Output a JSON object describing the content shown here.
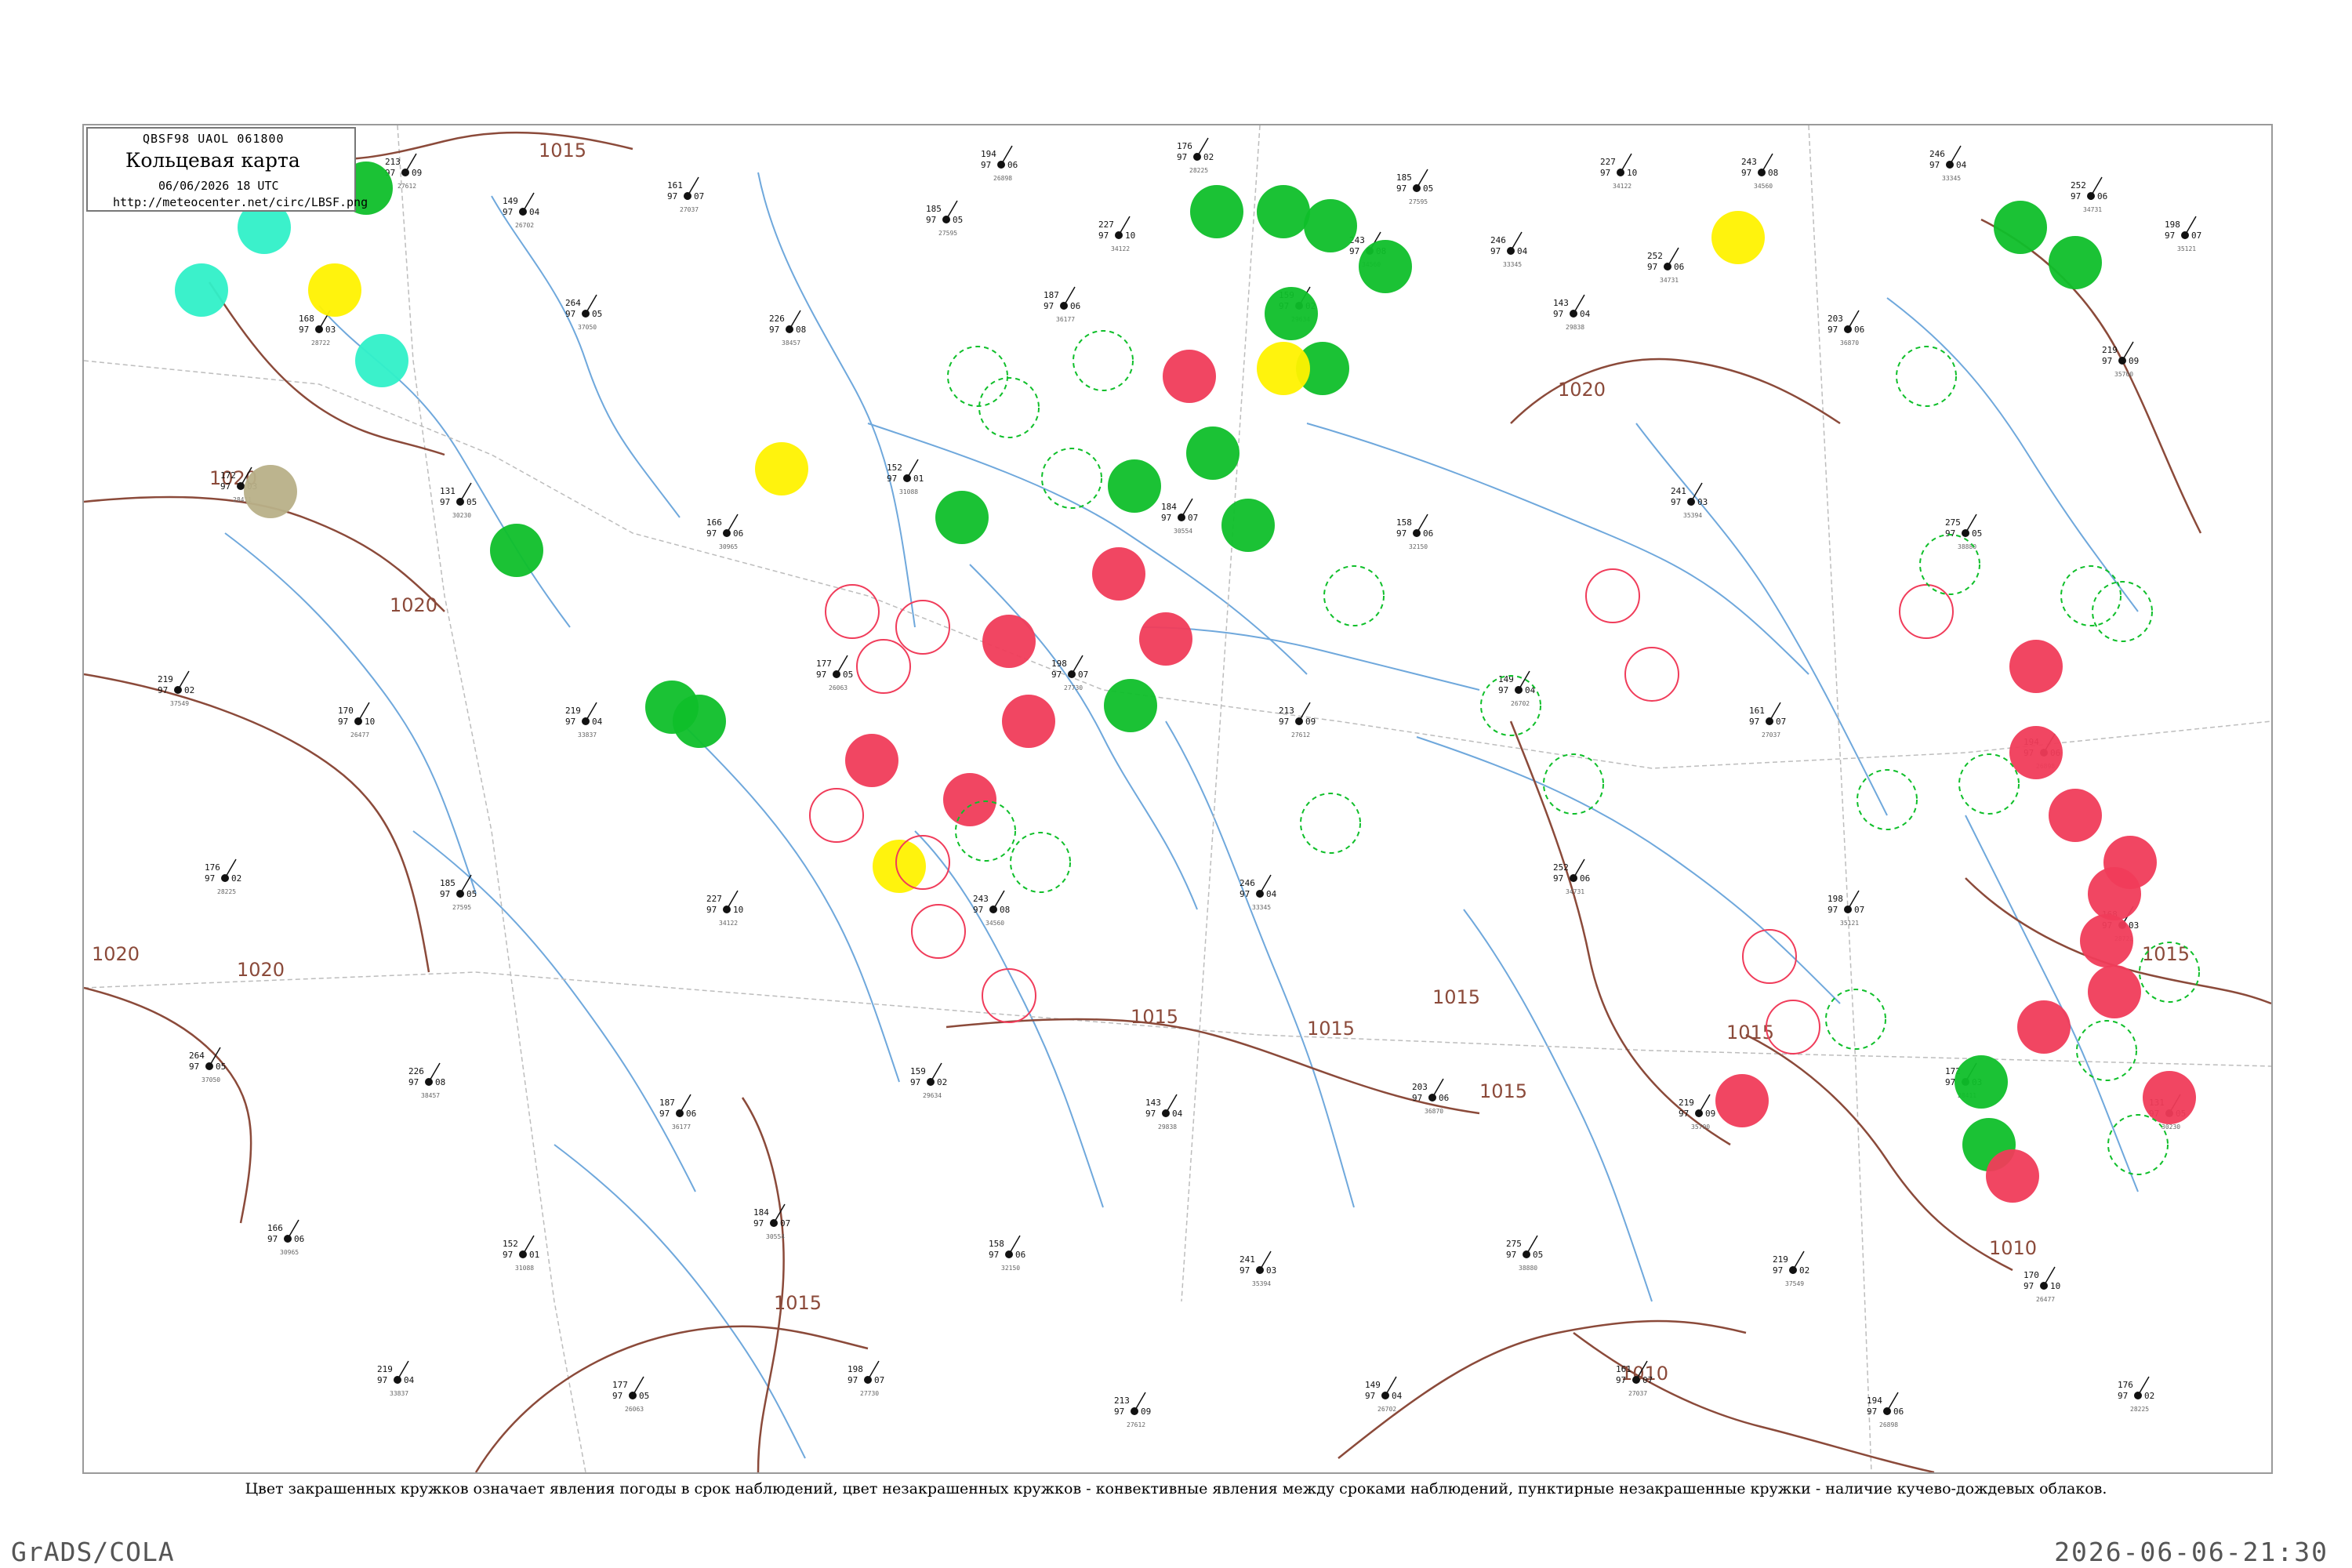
{
  "legend": {
    "header": "QBSF98  UAOL  061800",
    "title": "Кольцевая карта",
    "date": "06/06/2026 18 UTC",
    "url": "http://meteocenter.net/circ/LBSF.png"
  },
  "caption": "Цвет закрашенных кружков означает явления погоды в срок наблюдений, цвет незакрашенных кружков - конвективные явления между сроками наблюдений, пунктирные незакрашенные кружки - наличие кучево-дождевых облаков.",
  "footer": {
    "left": "GrADS/COLA",
    "right": "2026-06-06-21:30"
  },
  "colors": {
    "green": "#0fbf2a",
    "red": "#f03c5a",
    "yellow": "#fff200",
    "cyan": "#30f0c8",
    "olive": "#b8b088",
    "isobar": "#8b4a3a",
    "river": "#6fa8dc",
    "border": "#bdbdbd"
  },
  "isobars": [
    {
      "label": "1015"
    },
    {
      "label": "1020"
    },
    {
      "label": "1020"
    },
    {
      "label": "1020"
    },
    {
      "label": "1020"
    },
    {
      "label": "1015"
    },
    {
      "label": "1015"
    },
    {
      "label": "1015"
    },
    {
      "label": "1015"
    },
    {
      "label": "1015"
    },
    {
      "label": "1010"
    },
    {
      "label": "1010"
    },
    {
      "label": "1015"
    },
    {
      "label": "1015"
    },
    {
      "label": "1020"
    }
  ],
  "circles": [
    {
      "style": "filled",
      "color": "green"
    },
    {
      "style": "filled",
      "color": "green"
    },
    {
      "style": "filled",
      "color": "green"
    },
    {
      "style": "filled",
      "color": "cyan"
    },
    {
      "style": "filled",
      "color": "cyan"
    },
    {
      "style": "filled",
      "color": "yellow"
    },
    {
      "style": "filled",
      "color": "cyan"
    },
    {
      "style": "filled",
      "color": "olive"
    },
    {
      "style": "filled",
      "color": "green"
    },
    {
      "style": "filled",
      "color": "green"
    },
    {
      "style": "filled",
      "color": "yellow"
    },
    {
      "style": "filled",
      "color": "green"
    },
    {
      "style": "filled",
      "color": "green"
    },
    {
      "style": "filled",
      "color": "green"
    },
    {
      "style": "filled",
      "color": "green"
    },
    {
      "style": "filled",
      "color": "green"
    },
    {
      "style": "filled",
      "color": "green"
    },
    {
      "style": "filled",
      "color": "green"
    },
    {
      "style": "filled",
      "color": "red"
    },
    {
      "style": "filled",
      "color": "yellow"
    },
    {
      "style": "filled",
      "color": "green"
    },
    {
      "style": "filled",
      "color": "green"
    },
    {
      "style": "filled",
      "color": "green"
    },
    {
      "style": "filled",
      "color": "green"
    },
    {
      "style": "filled",
      "color": "red"
    },
    {
      "style": "filled",
      "color": "red"
    },
    {
      "style": "filled",
      "color": "red"
    },
    {
      "style": "filled",
      "color": "green"
    },
    {
      "style": "filled",
      "color": "red"
    },
    {
      "style": "filled",
      "color": "red"
    },
    {
      "style": "filled",
      "color": "red"
    },
    {
      "style": "filled",
      "color": "yellow"
    },
    {
      "style": "filled",
      "color": "green"
    },
    {
      "style": "filled",
      "color": "green"
    },
    {
      "style": "filled",
      "color": "red"
    },
    {
      "style": "filled",
      "color": "red"
    },
    {
      "style": "filled",
      "color": "red"
    },
    {
      "style": "filled",
      "color": "red"
    },
    {
      "style": "filled",
      "color": "red"
    },
    {
      "style": "filled",
      "color": "red"
    },
    {
      "style": "filled",
      "color": "red"
    },
    {
      "style": "filled",
      "color": "red"
    },
    {
      "style": "filled",
      "color": "red"
    },
    {
      "style": "filled",
      "color": "red"
    },
    {
      "style": "filled",
      "color": "green"
    },
    {
      "style": "filled",
      "color": "yellow"
    },
    {
      "style": "filled",
      "color": "green"
    },
    {
      "style": "filled",
      "color": "red"
    },
    {
      "style": "ring",
      "color": "red"
    },
    {
      "style": "ring",
      "color": "red"
    },
    {
      "style": "ring",
      "color": "red"
    },
    {
      "style": "ring",
      "color": "red"
    },
    {
      "style": "ring",
      "color": "red"
    },
    {
      "style": "ring",
      "color": "red"
    },
    {
      "style": "ring",
      "color": "red"
    },
    {
      "style": "ring",
      "color": "red"
    },
    {
      "style": "ring",
      "color": "red"
    },
    {
      "style": "ring",
      "color": "red"
    },
    {
      "style": "ring",
      "color": "red"
    },
    {
      "style": "ring",
      "color": "red"
    },
    {
      "style": "dashed",
      "color": "green"
    },
    {
      "style": "dashed",
      "color": "green"
    },
    {
      "style": "dashed",
      "color": "green"
    },
    {
      "style": "dashed",
      "color": "green"
    },
    {
      "style": "dashed",
      "color": "green"
    },
    {
      "style": "dashed",
      "color": "green"
    },
    {
      "style": "dashed",
      "color": "green"
    },
    {
      "style": "dashed",
      "color": "green"
    },
    {
      "style": "dashed",
      "color": "green"
    },
    {
      "style": "dashed",
      "color": "green"
    },
    {
      "style": "dashed",
      "color": "green"
    },
    {
      "style": "dashed",
      "color": "green"
    },
    {
      "style": "dashed",
      "color": "green"
    },
    {
      "style": "dashed",
      "color": "green"
    },
    {
      "style": "dashed",
      "color": "green"
    },
    {
      "style": "dashed",
      "color": "green"
    },
    {
      "style": "dashed",
      "color": "green"
    },
    {
      "style": "dashed",
      "color": "green"
    },
    {
      "style": "dashed",
      "color": "green"
    },
    {
      "style": "dashed",
      "color": "green"
    }
  ],
  "stations": [
    {
      "id": "27612",
      "t": "213",
      "p": "97",
      "d": "09"
    },
    {
      "id": "26702",
      "t": "149",
      "p": "97",
      "d": "04"
    },
    {
      "id": "27037",
      "t": "161",
      "p": "97",
      "d": "07"
    },
    {
      "id": "26898",
      "t": "194",
      "p": "97",
      "d": "06"
    },
    {
      "id": "28225",
      "t": "176",
      "p": "97",
      "d": "02"
    },
    {
      "id": "27595",
      "t": "185",
      "p": "97",
      "d": "05"
    },
    {
      "id": "34122",
      "t": "227",
      "p": "97",
      "d": "10"
    },
    {
      "id": "34560",
      "t": "243",
      "p": "97",
      "d": "08"
    },
    {
      "id": "33345",
      "t": "246",
      "p": "97",
      "d": "04"
    },
    {
      "id": "34731",
      "t": "252",
      "p": "97",
      "d": "06"
    },
    {
      "id": "35121",
      "t": "198",
      "p": "97",
      "d": "07"
    },
    {
      "id": "28722",
      "t": "168",
      "p": "97",
      "d": "03"
    },
    {
      "id": "37050",
      "t": "264",
      "p": "97",
      "d": "05"
    },
    {
      "id": "38457",
      "t": "226",
      "p": "97",
      "d": "08"
    },
    {
      "id": "36177",
      "t": "187",
      "p": "97",
      "d": "06"
    },
    {
      "id": "29634",
      "t": "159",
      "p": "97",
      "d": "02"
    },
    {
      "id": "29838",
      "t": "143",
      "p": "97",
      "d": "04"
    },
    {
      "id": "36870",
      "t": "203",
      "p": "97",
      "d": "06"
    },
    {
      "id": "35700",
      "t": "219",
      "p": "97",
      "d": "09"
    },
    {
      "id": "28411",
      "t": "172",
      "p": "97",
      "d": "03"
    },
    {
      "id": "30230",
      "t": "131",
      "p": "97",
      "d": "05"
    },
    {
      "id": "30965",
      "t": "166",
      "p": "97",
      "d": "06"
    },
    {
      "id": "31088",
      "t": "152",
      "p": "97",
      "d": "01"
    },
    {
      "id": "30554",
      "t": "184",
      "p": "97",
      "d": "07"
    },
    {
      "id": "32150",
      "t": "158",
      "p": "97",
      "d": "06"
    },
    {
      "id": "35394",
      "t": "241",
      "p": "97",
      "d": "03"
    },
    {
      "id": "38880",
      "t": "275",
      "p": "97",
      "d": "05"
    },
    {
      "id": "37549",
      "t": "219",
      "p": "97",
      "d": "02"
    },
    {
      "id": "26477",
      "t": "170",
      "p": "97",
      "d": "10"
    },
    {
      "id": "33837",
      "t": "219",
      "p": "97",
      "d": "04"
    },
    {
      "id": "26063",
      "t": "177",
      "p": "97",
      "d": "05"
    },
    {
      "id": "27730",
      "t": "198",
      "p": "97",
      "d": "07"
    }
  ]
}
